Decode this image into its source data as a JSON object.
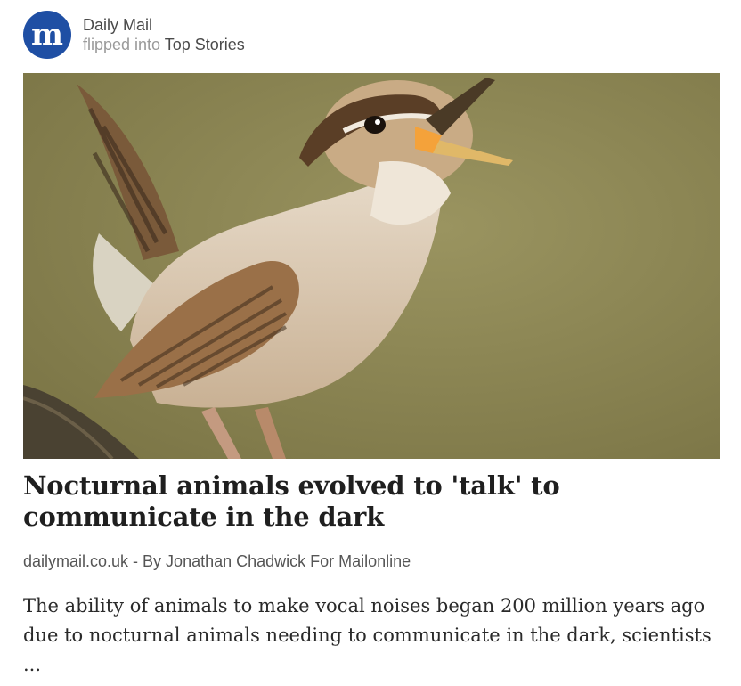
{
  "source": {
    "name": "Daily Mail",
    "logo_letter": "m",
    "logo_color": "#1f4fa4",
    "flipped_prefix": "flipped into",
    "magazine": "Top Stories"
  },
  "hero_image": {
    "subject": "singing wren",
    "icon": "photo"
  },
  "article": {
    "title": "Nocturnal animals evolved to 'talk' to communicate in the dark",
    "domain": "dailymail.co.uk",
    "separator": " - ",
    "author": "By Jonathan Chadwick For Mailonline",
    "excerpt": "The ability of animals to make vocal noises began 200 million years ago due to nocturnal animals needing to communicate in the dark, scientists ..."
  }
}
